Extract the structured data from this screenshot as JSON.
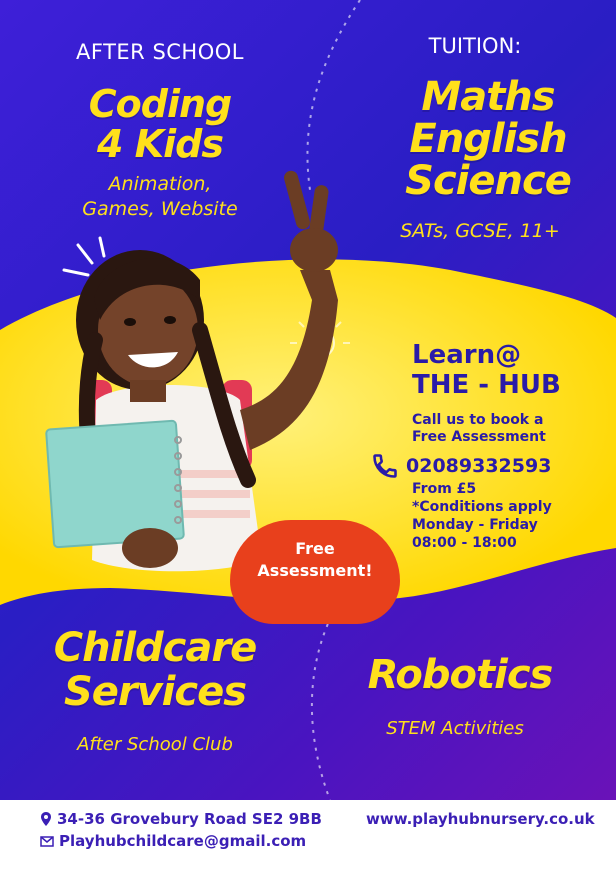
{
  "colors": {
    "primary": "#2a1ec4",
    "accent_yellow": "#ffe01b",
    "badge_red": "#e8401c",
    "dark_text": "#2a1ba8"
  },
  "top_left": {
    "heading": "AFTER SCHOOL",
    "title_line1": "Coding",
    "title_line2": "4 Kids",
    "sub_line1": "Animation,",
    "sub_line2": "Games, Website"
  },
  "top_right": {
    "heading": "TUITION:",
    "subjects": [
      "Maths",
      "English",
      "Science"
    ],
    "levels": "SATs, GCSE, 11+"
  },
  "center": {
    "learn_line1": "Learn@",
    "learn_line2": "THE - HUB",
    "call_line1": "Call us to book a",
    "call_line2": "Free Assessment",
    "phone_icon": "phone-icon",
    "phone": "02089332593",
    "from_label": "From",
    "price": "£5",
    "conditions": "*Conditions apply",
    "days": "Monday - Friday",
    "hours": "08:00 - 18:00"
  },
  "badge": {
    "line1": "Free",
    "line2": "Assessment!"
  },
  "bottom_left": {
    "title_line1": "Childcare",
    "title_line2": "Services",
    "sub": "After School Club"
  },
  "bottom_right": {
    "title": "Robotics",
    "sub": "STEM Activities"
  },
  "footer": {
    "address_icon": "location-pin-icon",
    "address": "34-36 Grovebury Road SE2 9BB",
    "email_icon": "mail-icon",
    "email": "Playhubchildcare@gmail.com",
    "website": "www.playhubnursery.co.uk"
  }
}
